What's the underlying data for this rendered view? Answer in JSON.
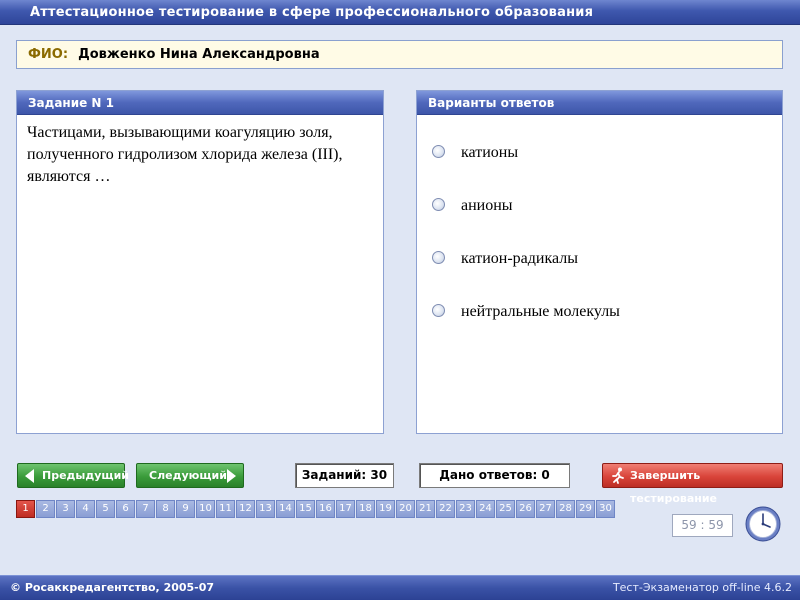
{
  "window": {
    "title": "Аттестационное тестирование в сфере профессионального образования"
  },
  "fio": {
    "label": "ФИО:",
    "name": "Довженко Нина Александровна"
  },
  "question_panel": {
    "header": "Задание N 1",
    "text": "Частицами, вызывающими коагуляцию золя, полученного гидролизом хлорида железа (III), являются …"
  },
  "answers_panel": {
    "header": "Варианты ответов",
    "options": [
      "катионы",
      "анионы",
      "катион-радикалы",
      "нейтральные молекулы"
    ]
  },
  "controls": {
    "prev_label": "Предыдущий",
    "next_label": "Следующий",
    "tasks_counter": "Заданий: 30",
    "answered_counter": "Дано ответов: 0",
    "finish_label": "Завершить тестирование"
  },
  "question_numbers": {
    "labels": [
      "1",
      "2",
      "3",
      "4",
      "5",
      "6",
      "7",
      "8",
      "9",
      "10",
      "11",
      "12",
      "13",
      "14",
      "15",
      "16",
      "17",
      "18",
      "19",
      "20",
      "21",
      "22",
      "23",
      "24",
      "25",
      "26",
      "27",
      "28",
      "29",
      "30"
    ],
    "active": "1"
  },
  "timer": {
    "value": "59 : 59"
  },
  "footer": {
    "copyright": "© Росаккредагентство, 2005-07",
    "version": "Тест-Экзаменатор off-line 4.6.2"
  },
  "colors": {
    "title_bar": "#3f58ae",
    "panel_header": "#5068bc",
    "nav_button": "#3a9b3a",
    "finish_button": "#d9443a",
    "active_question": "#bf2c22",
    "inactive_question": "#8a9ed4",
    "background": "#dfe6f4"
  },
  "icons": {
    "prev": "arrow-left-icon",
    "next": "arrow-right-icon",
    "finish": "running-man-icon",
    "timer": "clock-icon",
    "option": "radio-button-icon"
  }
}
